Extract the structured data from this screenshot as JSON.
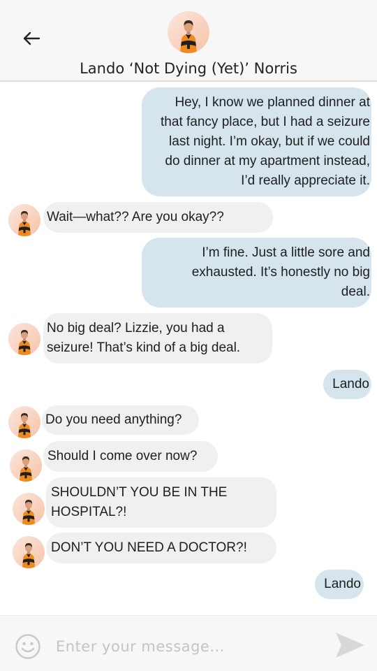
{
  "header": {
    "contact_name": "Lando ‘Not Dying (Yet)’ Norris",
    "back_icon": "arrow-left-icon",
    "avatar_icon": "contact-avatar"
  },
  "messages": [
    {
      "direction": "outgoing",
      "lines": [
        "Hey, I know we planned dinner at",
        "that fancy place, but I had a seizure",
        "last night. I’m okay, but if we could",
        "do dinner at my apartment instead,",
        "I’d really appreciate it."
      ]
    },
    {
      "direction": "incoming",
      "lines": [
        "Wait—what?? Are you okay??"
      ]
    },
    {
      "direction": "outgoing",
      "lines": [
        "I’m fine. Just a little sore and",
        "exhausted. It’s honestly no big",
        "deal."
      ]
    },
    {
      "direction": "incoming",
      "lines": [
        "No big deal? Lizzie, you had a",
        "seizure! That’s kind of a big deal."
      ]
    },
    {
      "direction": "outgoing",
      "lines": [
        "Lando"
      ]
    },
    {
      "direction": "incoming",
      "lines": [
        "Do you need anything?"
      ]
    },
    {
      "direction": "incoming",
      "lines": [
        "Should I come over now?"
      ]
    },
    {
      "direction": "incoming",
      "lines": [
        "SHOULDN’T YOU BE IN THE",
        "HOSPITAL?!"
      ]
    },
    {
      "direction": "incoming",
      "lines": [
        "DON’T YOU NEED A DOCTOR?!"
      ]
    },
    {
      "direction": "outgoing",
      "lines": [
        "Lando"
      ]
    }
  ],
  "composer": {
    "placeholder": "Enter your message...",
    "emoji_icon": "smiley-icon",
    "send_icon": "send-icon"
  },
  "colors": {
    "outgoing_bubble": "#d6e4ee",
    "incoming_bubble": "#f0f0f0",
    "header_bg": "#f7f7f7",
    "avatar_bg": "#f8d8c4",
    "jersey_orange": "#f08a1c"
  }
}
